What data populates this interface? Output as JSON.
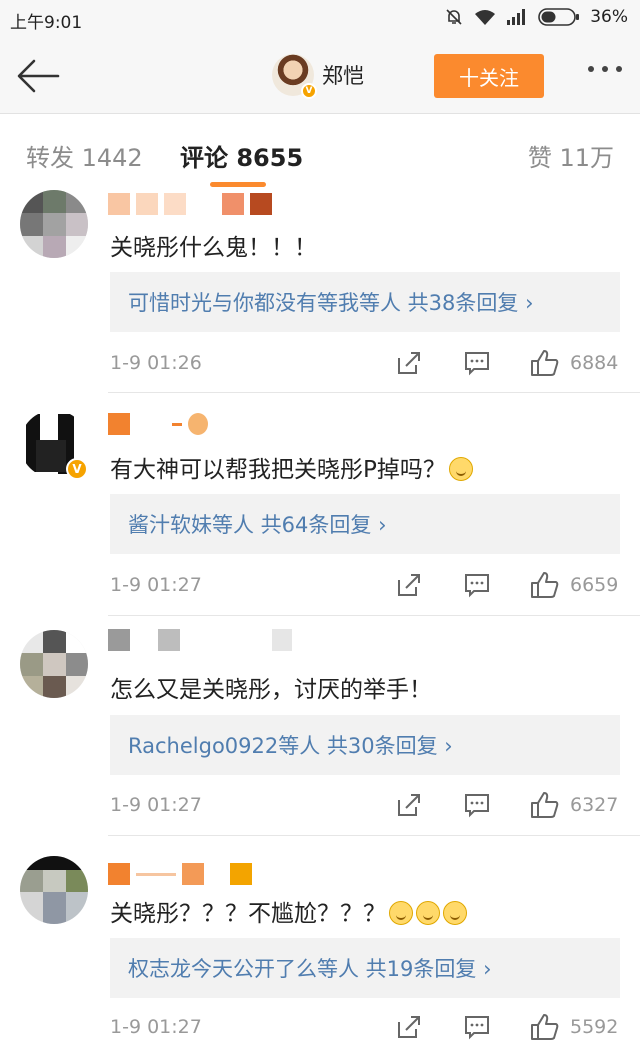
{
  "status": {
    "time": "上午9:01",
    "battery": "36%"
  },
  "nav": {
    "user_name": "郑恺",
    "follow_label": "十关注"
  },
  "tabs": {
    "repost": "转发 1442",
    "comments": "评论 8655",
    "likes": "赞 11万"
  },
  "comments": [
    {
      "content": "关晓彤什么鬼！！！",
      "replies": "可惜时光与你都没有等我等人  共38条回复 ›",
      "time": "1-9 01:26",
      "likes": "6884"
    },
    {
      "content": "有大神可以帮我把关晓彤P掉吗？",
      "replies": "酱汁软妹等人  共64条回复 ›",
      "time": "1-9 01:27",
      "likes": "6659"
    },
    {
      "content": "怎么又是关晓彤，讨厌的举手！",
      "replies": "Rachelgo0922等人  共30条回复 ›",
      "time": "1-9 01:27",
      "likes": "6327"
    },
    {
      "content": "关晓彤？？？不尴尬？？？",
      "replies": "权志龙今天公开了么等人  共19条回复 ›",
      "time": "1-9 01:27",
      "likes": "5592"
    }
  ],
  "colors": {
    "accent": "#fb8a2e",
    "link": "#507daf",
    "reply_bg": "#f2f2f2"
  }
}
